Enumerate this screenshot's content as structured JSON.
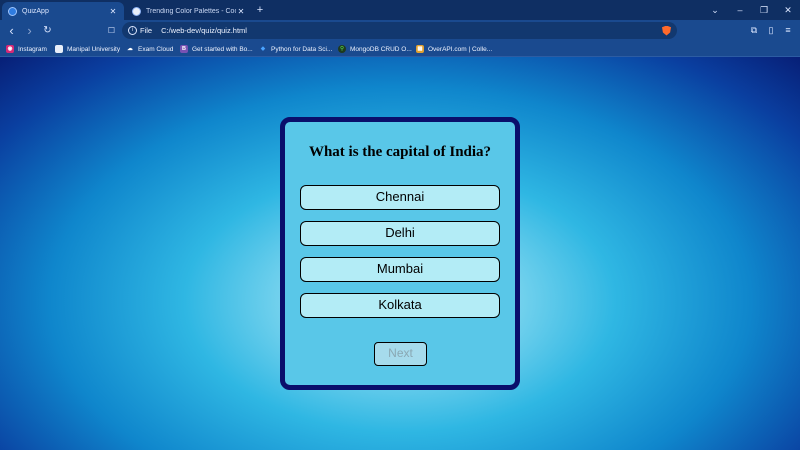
{
  "browser": {
    "tabs": [
      {
        "title": "QuizApp",
        "close": "✕"
      },
      {
        "title": "Trending Color Palettes - Coolors",
        "close": "✕"
      }
    ],
    "new_tab": "+",
    "window_controls": {
      "tab_search": "⌄",
      "minimize": "–",
      "restore": "❐",
      "close": "✕"
    },
    "nav": {
      "back": "‹",
      "forward": "›",
      "reload": "↻",
      "bookmark": "☐"
    },
    "address": {
      "scheme_label": "File",
      "url": "C:/web-dev/quiz/quiz.html"
    },
    "bookmarks": [
      {
        "label": "Instagram",
        "icon": "instagram-icon",
        "color": "#d62976",
        "glyph": "◉"
      },
      {
        "label": "Manipal University",
        "icon": "document-icon",
        "color": "#e8eef9",
        "glyph": ""
      },
      {
        "label": "Exam Cloud",
        "icon": "cloud-icon",
        "color": "#1a4a8f",
        "glyph": "☁"
      },
      {
        "label": "Get started with Bo...",
        "icon": "bootstrap-icon",
        "color": "#7952b3",
        "glyph": "B"
      },
      {
        "label": "Python for Data Sci...",
        "icon": "python-icon",
        "color": "#1a4a8f",
        "glyph": "◆"
      },
      {
        "label": "MongoDB CRUD O...",
        "icon": "mongodb-icon",
        "color": "#1e3a1e",
        "glyph": "⚲"
      },
      {
        "label": "OverAPI.com | Colle...",
        "icon": "overapi-icon",
        "color": "#e0a030",
        "glyph": "▦"
      }
    ]
  },
  "quiz": {
    "question": "What is the capital of India?",
    "answers": [
      "Chennai",
      "Delhi",
      "Mumbai",
      "Kolkata"
    ],
    "next_label": "Next"
  },
  "colors": {
    "card_border": "#0a0f6b",
    "card_background": "#59c7e8",
    "answer_background": "#b3ecf6"
  }
}
